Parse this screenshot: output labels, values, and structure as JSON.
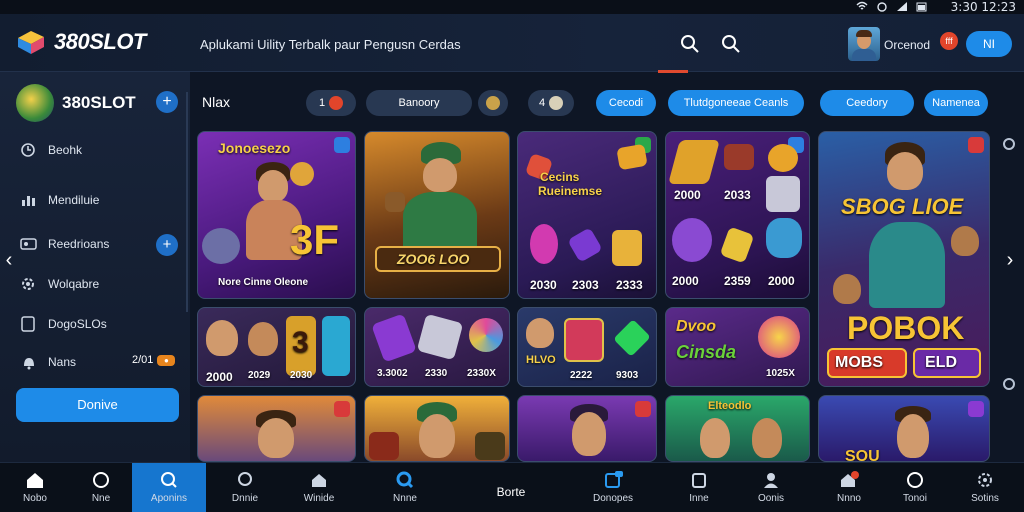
{
  "status_bar": {
    "time": "3:30 12:23"
  },
  "header": {
    "brand": "380SLOT",
    "tagline": "Aplukami Uility Terbalk paur Pengusn Cerdas",
    "user_name": "Orcenod",
    "notif_count": "fff",
    "lang_button": "NI"
  },
  "sidebar": {
    "brand": "380SLOT",
    "items": [
      {
        "label": "Beohk",
        "icon": "clock-icon"
      },
      {
        "label": "Mendiluie",
        "icon": "chart-icon"
      },
      {
        "label": "Reedrioans",
        "icon": "id-card-icon"
      },
      {
        "label": "Wolqabre",
        "icon": "gear-icon"
      },
      {
        "label": "DogoSLOs",
        "icon": "tablet-icon"
      },
      {
        "label": "Nans",
        "icon": "bell-icon"
      }
    ],
    "nans_count": "2/01",
    "cta_label": "Donive"
  },
  "filters": {
    "label": "Nlax",
    "chips": [
      "1",
      "Banoory",
      "",
      "4",
      "Cecodi",
      "Tlutdgoneeae Ceanls",
      "Ceedory",
      "Namenea"
    ]
  },
  "cards": [
    {
      "title": "Jonoesezo",
      "subtitle": "Nore Cinne Oleone",
      "big": "3F"
    },
    {
      "title": "",
      "subtitle": "ZOO6 LOO",
      "big": ""
    },
    {
      "title": "Cecins",
      "subtitle": "Rueinemse",
      "nums": [
        "2030",
        "2303",
        "2333"
      ]
    },
    {
      "title": "",
      "subtitle": "",
      "nums": [
        "2000",
        "2033",
        "2000",
        "2359",
        "2000"
      ]
    },
    {
      "title": "SBOG LIOE",
      "subtitle": "POBOK",
      "tags": [
        "MOBS",
        "ELD"
      ]
    },
    {
      "title": "",
      "subtitle": "",
      "nums": [
        "2000",
        "2029",
        "2030"
      ],
      "big": "3"
    },
    {
      "title": "",
      "subtitle": "",
      "nums": [
        "3.3002",
        "2330",
        "2330X"
      ]
    },
    {
      "title": "",
      "subtitle": "HLVO",
      "nums": [
        "2222",
        "9303"
      ]
    },
    {
      "title": "Dvoo",
      "subtitle": "Cinsda",
      "nums": [
        "1025X"
      ]
    },
    {
      "title": "Elteodlo",
      "subtitle": "",
      "nums": []
    },
    {
      "title": "",
      "subtitle": "",
      "nums": []
    },
    {
      "title": "",
      "subtitle": "",
      "nums": []
    },
    {
      "title": "",
      "subtitle": "",
      "nums": []
    },
    {
      "title": "SOU",
      "subtitle": "",
      "nums": []
    }
  ],
  "bottom_nav": [
    {
      "label": "Nobo",
      "icon": "home-icon"
    },
    {
      "label": "Nne",
      "icon": "circle-icon"
    },
    {
      "label": "Aponins",
      "icon": "search-icon"
    },
    {
      "label": "Dnnie",
      "icon": "chat-icon"
    },
    {
      "label": "Winide",
      "icon": "house-icon"
    },
    {
      "label": "Nnne",
      "icon": "search-icon"
    },
    {
      "label": "Borte",
      "icon": ""
    },
    {
      "label": "Donopes",
      "icon": "grid-icon"
    },
    {
      "label": "Inne",
      "icon": "square-icon"
    },
    {
      "label": "Oonis",
      "icon": "user-icon"
    },
    {
      "label": "Nnno",
      "icon": "home-badge-icon"
    },
    {
      "label": "Tonoi",
      "icon": "circle-icon"
    },
    {
      "label": "Sotins",
      "icon": "settings-icon"
    }
  ],
  "colors": {
    "accent": "#1e8be8",
    "alert": "#e2452b",
    "bg": "#0e1625"
  }
}
